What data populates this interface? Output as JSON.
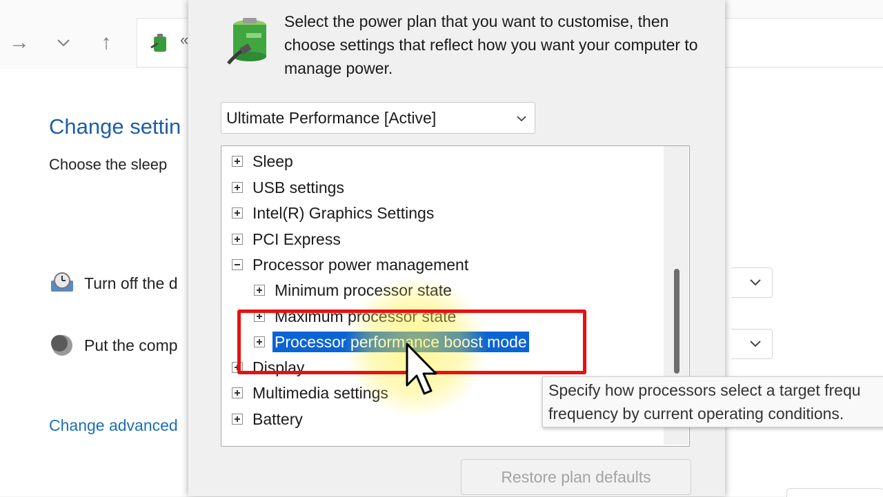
{
  "background": {
    "title": "Change settin",
    "subtitle": "Choose the sleep",
    "display_row": "Turn off the d",
    "sleep_row": "Put the comp",
    "advanced_link": "Change advanced"
  },
  "dialog": {
    "description": "Select the power plan that you want to customise, then choose settings that reflect how you want your computer to manage power.",
    "plan_select": {
      "value": "Ultimate Performance [Active]"
    },
    "tree": {
      "items": [
        {
          "label": "Sleep",
          "expanded": false
        },
        {
          "label": "USB settings",
          "expanded": false
        },
        {
          "label": "Intel(R) Graphics Settings",
          "expanded": false
        },
        {
          "label": "PCI Express",
          "expanded": false
        },
        {
          "label": "Processor power management",
          "expanded": true
        },
        {
          "label": "Minimum processor state",
          "expanded": false
        },
        {
          "label": "Maximum processor state",
          "expanded": false
        },
        {
          "label": "Processor performance boost mode",
          "expanded": false,
          "selected": true
        },
        {
          "label": "Display",
          "expanded": false
        },
        {
          "label": "Multimedia settings",
          "expanded": false
        },
        {
          "label": "Battery",
          "expanded": false
        }
      ]
    },
    "tooltip": {
      "line1": "Specify how processors select a target frequ",
      "line2": "frequency by current operating conditions."
    },
    "restore_button": "Restore plan defaults"
  },
  "colors": {
    "selection": "#0a64d4",
    "highlight_border": "#ea1010",
    "link": "#1b6fb5",
    "title": "#1b5ea8"
  }
}
